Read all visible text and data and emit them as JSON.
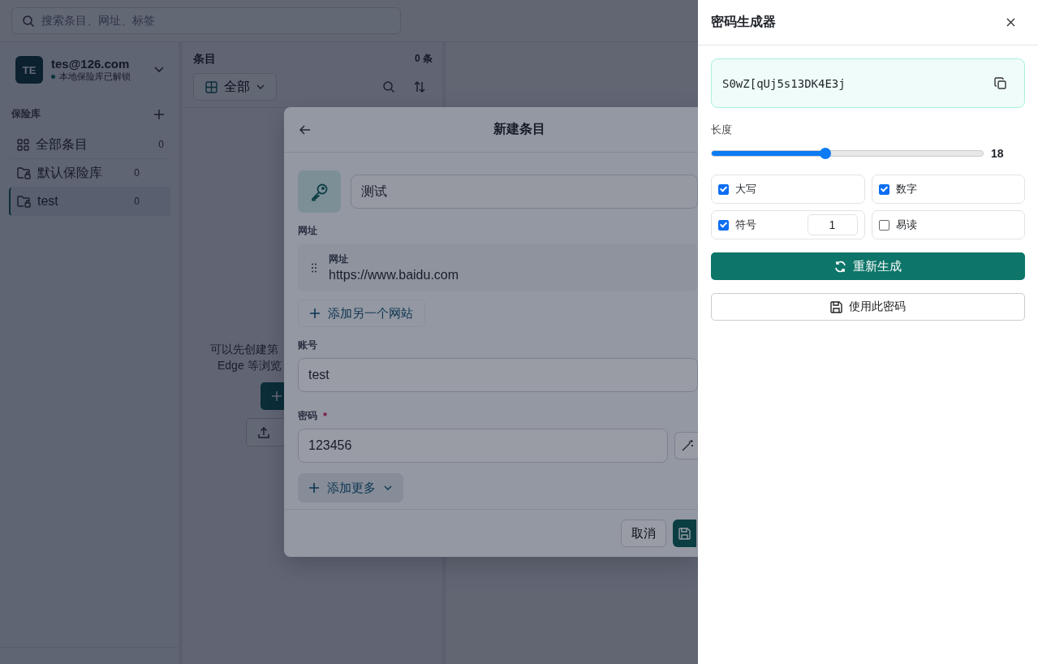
{
  "search": {
    "placeholder": "搜索条目、网址、标签"
  },
  "account": {
    "initials": "TE",
    "email": "tes@126.com",
    "status": "本地保险库已解锁"
  },
  "vaults": {
    "title": "保险库",
    "items": [
      {
        "kind": "all",
        "label": "全部条目",
        "count": "0",
        "selected": false
      },
      {
        "kind": "vault",
        "label": "默认保险库",
        "count": "0",
        "selected": false
      },
      {
        "kind": "vault",
        "label": "test",
        "count": "0",
        "selected": true
      }
    ]
  },
  "list": {
    "title": "条目",
    "count": "0 条",
    "filter": "全部"
  },
  "empty_state": {
    "lines": [
      "可以先创建第",
      "Edge 等浏览"
    ]
  },
  "modal": {
    "title": "新建条目",
    "name_value": "测试",
    "url_section": "网址",
    "urls": [
      {
        "label": "网址",
        "value": "https://www.baidu.com"
      }
    ],
    "add_url": "添加另一个网站",
    "account_label": "账号",
    "account_value": "test",
    "password_label": "密码",
    "required_mark": "*",
    "password_value": "123456",
    "add_more": "添加更多",
    "cancel": "取消"
  },
  "generator": {
    "title": "密码生成器",
    "password": "S0wZ[qUj5s13DK4E3j",
    "length_label": "长度",
    "level": 0.42,
    "length_value": "18",
    "options": [
      {
        "kind": "check",
        "label": "大写",
        "checked": true
      },
      {
        "kind": "check",
        "label": "数字",
        "checked": true
      },
      {
        "kind": "count",
        "label": "符号",
        "checked": true,
        "value": "1"
      },
      {
        "kind": "check",
        "label": "易读",
        "checked": false
      }
    ],
    "regenerate": "重新生成",
    "use": "使用此密码"
  }
}
